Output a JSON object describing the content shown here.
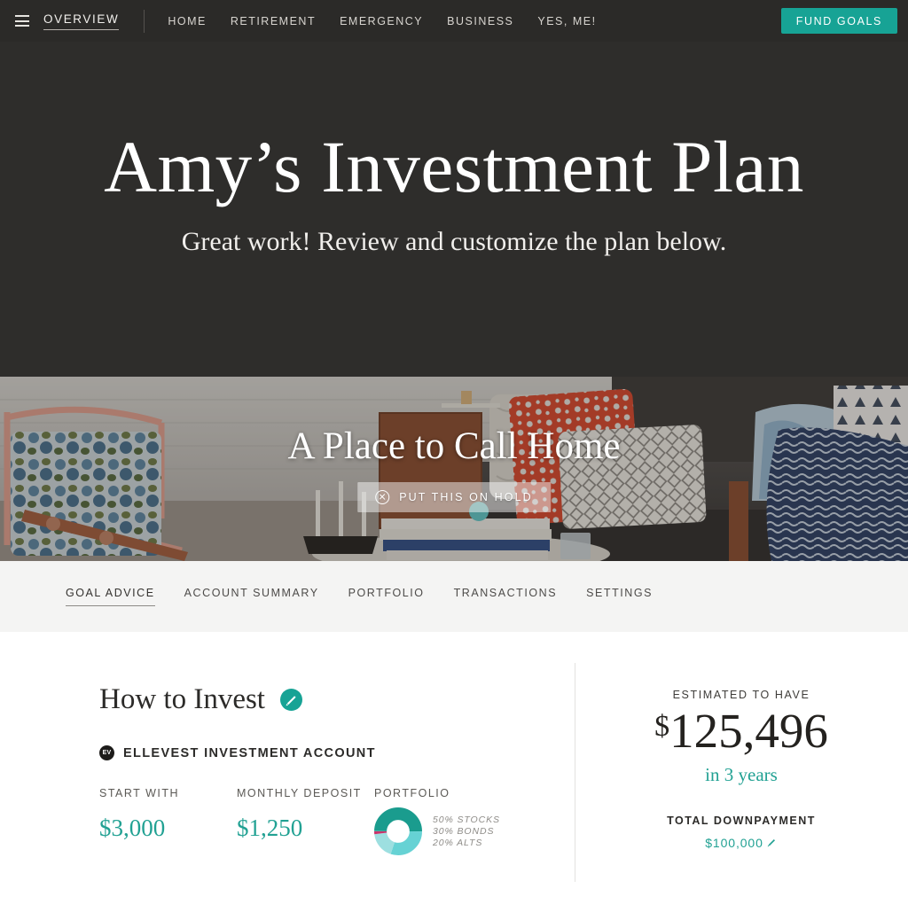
{
  "topnav": {
    "menu_icon": "hamburger-icon",
    "overview_label": "OVERVIEW",
    "links": [
      {
        "label": "HOME"
      },
      {
        "label": "RETIREMENT"
      },
      {
        "label": "EMERGENCY"
      },
      {
        "label": "BUSINESS"
      },
      {
        "label": "YES, ME!"
      }
    ],
    "cta_label": "FUND GOALS",
    "cta_color": "#17a395",
    "background": "#2b2a28"
  },
  "hero": {
    "title": "Amy’s Investment Plan",
    "subtitle": "Great work! Review and customize the plan below.",
    "background": "#2e2d2b"
  },
  "banner": {
    "title": "A Place to Call Home",
    "hold_button_label": "PUT THIS ON HOLD",
    "hold_button_icon": "circle-x-icon"
  },
  "tabs": [
    {
      "label": "GOAL ADVICE",
      "active": true
    },
    {
      "label": "ACCOUNT SUMMARY",
      "active": false
    },
    {
      "label": "PORTFOLIO",
      "active": false
    },
    {
      "label": "TRANSACTIONS",
      "active": false
    },
    {
      "label": "SETTINGS",
      "active": false
    }
  ],
  "how_to_invest": {
    "heading": "How to Invest",
    "edit_icon": "pencil-edit-icon",
    "account_badge": "EV",
    "account_name": "ELLEVEST INVESTMENT ACCOUNT",
    "stats": [
      {
        "label": "START WITH",
        "value": "$3,000"
      },
      {
        "label": "MONTHLY DEPOSIT",
        "value": "$1,250"
      }
    ],
    "portfolio": {
      "label": "PORTFOLIO",
      "legend": [
        "50% STOCKS",
        "30% BONDS",
        "20% ALTS"
      ]
    }
  },
  "summary": {
    "estimate_label": "ESTIMATED TO HAVE",
    "estimate_currency": "$",
    "estimate_amount": "125,496",
    "estimate_timeframe": "in 3 years",
    "downpayment_label": "TOTAL DOWNPAYMENT",
    "downpayment_value": "$100,000",
    "downpayment_edit_icon": "pencil-edit-icon"
  },
  "chart_data": {
    "type": "pie",
    "title": "PORTFOLIO",
    "categories": [
      "Stocks",
      "Bonds",
      "Alts",
      "Other"
    ],
    "values": [
      50,
      30,
      18,
      2
    ],
    "labels": [
      "50% STOCKS",
      "30% BONDS",
      "20% ALTS",
      ""
    ],
    "colors": [
      "#1a9c8e",
      "#66d2d4",
      "#9ddfe0",
      "#c9346b"
    ],
    "donut": true,
    "legend_position": "right"
  },
  "theme": {
    "teal": "#21a193",
    "dark": "#2b2a28",
    "tabbar_bg": "#f4f4f3"
  }
}
